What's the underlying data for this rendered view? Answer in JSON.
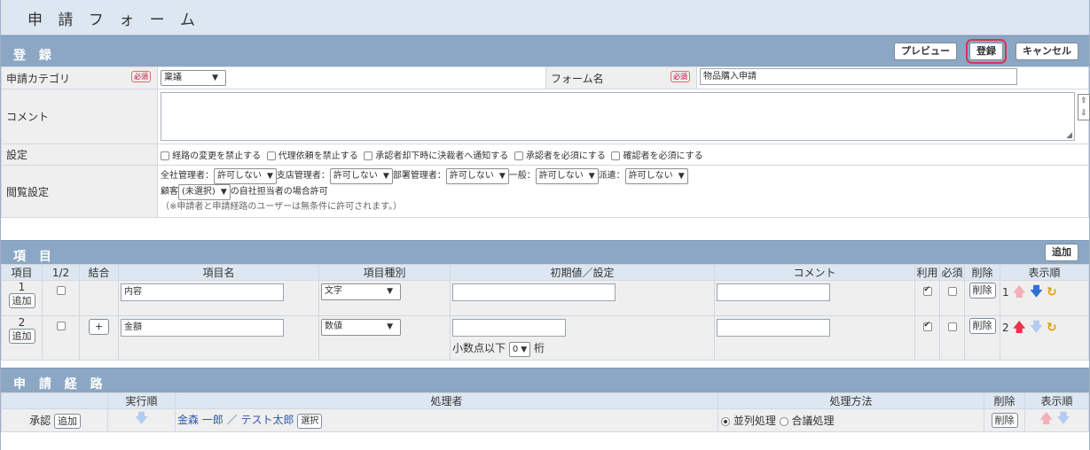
{
  "page_title": "申 請 フ ォ ー ム",
  "register": {
    "heading": "登 録",
    "preview_label": "プレビュー",
    "submit_label": "登録",
    "cancel_label": "キャンセル",
    "required_badge": "必須",
    "category_label": "申請カテゴリ",
    "category_value": "稟議",
    "form_name_label": "フォーム名",
    "form_name_value": "物品購入申請",
    "comment_label": "コメント",
    "settings_label": "設定",
    "settings_options": [
      "経路の変更を禁止する",
      "代理依頼を禁止する",
      "承認者却下時に決裁者へ通知する",
      "承認者を必須にする",
      "確認者を必須にする"
    ],
    "view_label": "閲覧設定",
    "view_perms": [
      {
        "label": "全社管理者：",
        "value": "許可しない"
      },
      {
        "label": "支店管理者：",
        "value": "許可しない"
      },
      {
        "label": "部署管理者：",
        "value": "許可しない"
      },
      {
        "label": "一般：",
        "value": "許可しない"
      },
      {
        "label": "派遣：",
        "value": "許可しない"
      }
    ],
    "customer_label": "顧客",
    "customer_value": "(未選択)",
    "customer_suffix": "の自社担当者の場合許可",
    "view_note": "（※申請者と申請経路のユーザーは無条件に許可されます。）"
  },
  "items": {
    "heading": "項 目",
    "add_label": "追加",
    "headers": [
      "項目",
      "1/2",
      "結合",
      "項目名",
      "項目種別",
      "初期値／設定",
      "コメント",
      "利用",
      "必須",
      "削除",
      "表示順"
    ],
    "rows": [
      {
        "no": "1",
        "add": "追加",
        "name": "内容",
        "type": "文字",
        "use": true,
        "required": false,
        "delete": "削除",
        "order": "1"
      },
      {
        "no": "2",
        "add": "追加",
        "join": "+",
        "name": "金額",
        "type": "数値",
        "decimal_label": "小数点以下",
        "decimal_value": "0",
        "decimal_unit": "桁",
        "use": true,
        "required": false,
        "delete": "削除",
        "order": "2"
      }
    ]
  },
  "route": {
    "heading": "申 請 経 路",
    "headers": [
      "実行順",
      "処理者",
      "処理方法",
      "削除",
      "表示順"
    ],
    "row": {
      "label": "承認",
      "add": "追加",
      "handler": "金森 一郎 ／ テスト太郎",
      "select": "選択",
      "method_parallel": "並列処理",
      "method_council": "合議処理",
      "delete": "削除"
    }
  }
}
